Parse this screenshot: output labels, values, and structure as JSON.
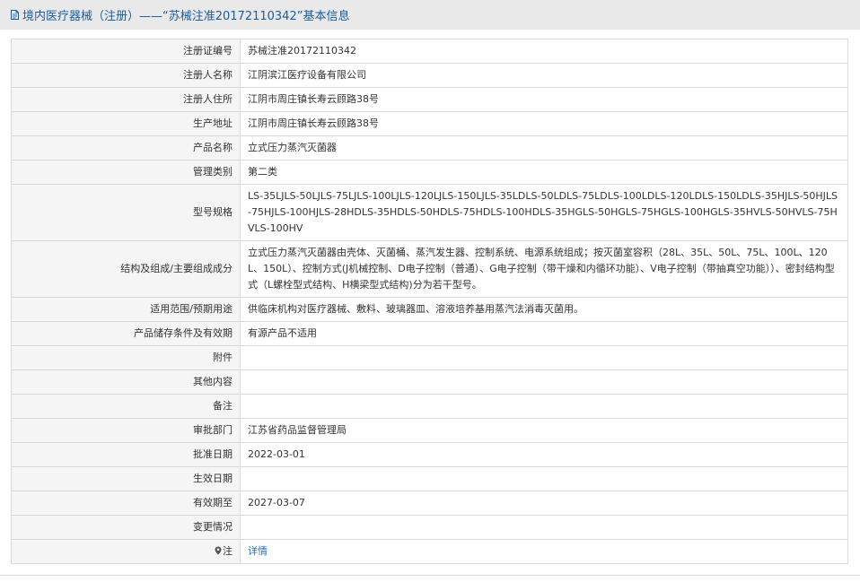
{
  "header": {
    "title": "境内医疗器械（注册）——“苏械注准20172110342”基本信息"
  },
  "rows": [
    {
      "label": "注册证编号",
      "value": "苏械注准20172110342"
    },
    {
      "label": "注册人名称",
      "value": "江阴滨江医疗设备有限公司"
    },
    {
      "label": "注册人住所",
      "value": "江阴市周庄镇长寿云顾路38号"
    },
    {
      "label": "生产地址",
      "value": "江阴市周庄镇长寿云顾路38号"
    },
    {
      "label": "产品名称",
      "value": "立式压力蒸汽灭菌器"
    },
    {
      "label": "管理类别",
      "value": "第二类"
    },
    {
      "label": "型号规格",
      "value": "LS-35LJLS-50LJLS-75LJLS-100LJLS-120LJLS-150LJLS-35LDLS-50LDLS-75LDLS-100LDLS-120LDLS-150LDLS-35HJLS-50HJLS-75HJLS-100HJLS-28HDLS-35HDLS-50HDLS-75HDLS-100HDLS-35HGLS-50HGLS-75HGLS-100HGLS-35HVLS-50HVLS-75HVLS-100HV"
    },
    {
      "label": "结构及组成/主要组成成分",
      "value": "立式压力蒸汽灭菌器由壳体、灭菌桶、蒸汽发生器、控制系统、电源系统组成；按灭菌室容积（28L、35L、50L、75L、100L、120L、150L）、控制方式(J机械控制、D电子控制（普通）、G电子控制（带干燥和内循环功能）、V电子控制（带抽真空功能））、密封结构型式（L螺栓型式结构、H横梁型式结构)分为若干型号。"
    },
    {
      "label": "适用范围/预期用途",
      "value": "供临床机构对医疗器械、敷料、玻璃器皿、溶液培养基用蒸汽法消毒灭菌用。"
    },
    {
      "label": "产品储存条件及有效期",
      "value": "有源产品不适用"
    },
    {
      "label": "附件",
      "value": ""
    },
    {
      "label": "其他内容",
      "value": ""
    },
    {
      "label": "备注",
      "value": ""
    },
    {
      "label": "审批部门",
      "value": "江苏省药品监督管理局"
    },
    {
      "label": "批准日期",
      "value": "2022-03-01"
    },
    {
      "label": "生效日期",
      "value": ""
    },
    {
      "label": "有效期至",
      "value": "2027-03-07"
    },
    {
      "label": "变更情况",
      "value": ""
    }
  ],
  "note": {
    "label": "注",
    "icon": "map-pin-icon",
    "link_text": "详情"
  },
  "colors": {
    "title_text": "#1a5c9e",
    "title_bg": "#e9e9e9",
    "label_bg": "#f5f5f5",
    "border": "#d9d9d9",
    "link": "#1a6fc4"
  }
}
